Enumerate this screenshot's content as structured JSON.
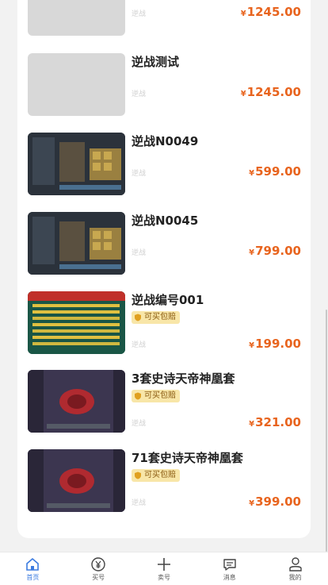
{
  "listings": [
    {
      "title": "",
      "tag": "",
      "game": "逆战",
      "price": "1245.00",
      "thumb": "placeholder"
    },
    {
      "title": "逆战测试",
      "tag": "",
      "game": "逆战",
      "price": "1245.00",
      "thumb": "placeholder"
    },
    {
      "title": "逆战N0049",
      "tag": "",
      "game": "逆战",
      "price": "599.00",
      "thumb": "dark"
    },
    {
      "title": "逆战N0045",
      "tag": "",
      "game": "逆战",
      "price": "799.00",
      "thumb": "dark"
    },
    {
      "title": "逆战编号001",
      "tag": "可买包赔",
      "game": "逆战",
      "price": "199.00",
      "thumb": "green"
    },
    {
      "title": "3套史诗天帝神凰套",
      "tag": "可买包赔",
      "game": "逆战",
      "price": "321.00",
      "thumb": "purple"
    },
    {
      "title": "71套史诗天帝神凰套",
      "tag": "可买包赔",
      "game": "逆战",
      "price": "399.00",
      "thumb": "purple"
    }
  ],
  "currency_symbol": "¥",
  "tabbar": {
    "home": "首页",
    "buy": "买号",
    "sell": "卖号",
    "messages": "消息",
    "mine": "我的"
  },
  "colors": {
    "price": "#e8641e",
    "accent": "#3b7be0",
    "tag_bg": "#f8e6a8"
  }
}
